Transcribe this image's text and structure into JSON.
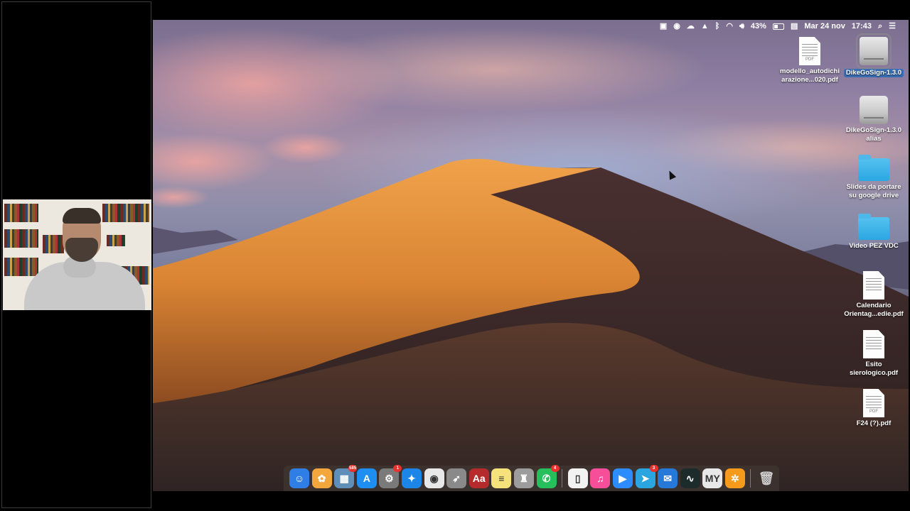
{
  "menubar": {
    "battery_percent": "43%",
    "date": "Mar 24 nov",
    "time": "17:43",
    "icons": [
      "video-icon",
      "zoom-icon",
      "cloud-icon",
      "drive-icon",
      "bluetooth-icon",
      "wifi-icon",
      "volume-icon",
      "battery-icon",
      "keyboard-icon",
      "spotlight-icon",
      "notification-center-icon"
    ]
  },
  "desktop": {
    "items": [
      {
        "label": "modello_autodichi arazione...020.pdf",
        "type": "pdf",
        "tag": "PDF"
      },
      {
        "label": "DikeGoSign-1.3.0",
        "type": "drive",
        "selected": true
      },
      {
        "label": "DikeGoSign-1.3.0 alias",
        "type": "drive"
      },
      {
        "label": "Slides da portare su google drive",
        "type": "folder"
      },
      {
        "label": "Video PEZ VDC",
        "type": "folder"
      },
      {
        "label": "Calendario Orientag...edie.pdf",
        "type": "pdf"
      },
      {
        "label": "Esito sierologico.pdf",
        "type": "pdf"
      },
      {
        "label": "F24 (?).pdf",
        "type": "pdf",
        "tag": "PDF"
      }
    ]
  },
  "dock": {
    "apps": [
      {
        "name": "finder",
        "color": "#2f7ee6",
        "glyph": "☺"
      },
      {
        "name": "photos",
        "color": "#f2a63c",
        "glyph": "✿"
      },
      {
        "name": "preview",
        "color": "#5f8fb8",
        "glyph": "▦",
        "badge": "585"
      },
      {
        "name": "app-store",
        "color": "#1e8ff0",
        "glyph": "A"
      },
      {
        "name": "system-preferences",
        "color": "#7a7a7a",
        "glyph": "⚙",
        "badge": "1"
      },
      {
        "name": "safari",
        "color": "#1b86e8",
        "glyph": "✦"
      },
      {
        "name": "chrome",
        "color": "#e8e8e8",
        "glyph": "◉"
      },
      {
        "name": "launchpad",
        "color": "#8a8a8a",
        "glyph": "➶"
      },
      {
        "name": "dictionary",
        "color": "#b52b2b",
        "glyph": "Aa"
      },
      {
        "name": "notes",
        "color": "#f6e27a",
        "glyph": "≡"
      },
      {
        "name": "automator",
        "color": "#9c9c9c",
        "glyph": "♜"
      },
      {
        "name": "whatsapp",
        "color": "#25c05c",
        "glyph": "✆",
        "badge": "4"
      },
      {
        "name": "textedit",
        "color": "#f2f2f2",
        "glyph": "▯"
      },
      {
        "name": "itunes",
        "color": "#f74e9a",
        "glyph": "♫"
      },
      {
        "name": "zoom",
        "color": "#2d8cff",
        "glyph": "▶"
      },
      {
        "name": "telegram",
        "color": "#2aa5e0",
        "glyph": "➤",
        "badge": "3"
      },
      {
        "name": "mail",
        "color": "#2679d8",
        "glyph": "✉"
      },
      {
        "name": "activity-monitor",
        "color": "#1d2b2b",
        "glyph": "∿"
      },
      {
        "name": "my-training",
        "color": "#e8e8e8",
        "glyph": "MY"
      },
      {
        "name": "vlc",
        "color": "#f59a1b",
        "glyph": "✲"
      }
    ],
    "trash": {
      "name": "trash",
      "color": "#9a9a9a",
      "glyph": "🗑"
    }
  }
}
